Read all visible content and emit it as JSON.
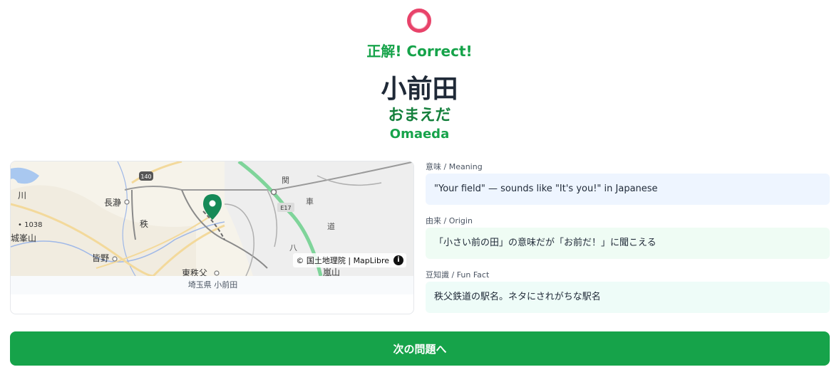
{
  "result": {
    "icon": "circle-correct-icon",
    "verdict": "正解! Correct!",
    "accent_color": "#16a34a",
    "icon_color": "#e8436a"
  },
  "station": {
    "kanji": "小前田",
    "kana": "おまえだ",
    "romaji": "Omaeda"
  },
  "map": {
    "labels": {
      "route_140": "140",
      "nagatoro": "長瀞",
      "kawa": "川",
      "chichi": "秩",
      "elevation": "• 1038",
      "jogamine": "城峯山",
      "minano": "皆野",
      "route_e17": "E17",
      "higashichichibu": "東秩父",
      "ranzan": "嵐山",
      "road_kanji_1": "八",
      "road_kanji_2": "車",
      "road_kanji_3": "道",
      "road_kanji_4": "関"
    },
    "attribution": "© 国土地理院 | MapLibre",
    "info_symbol": "i",
    "caption": "埼玉県 小前田"
  },
  "details": {
    "meaning_label": "意味 / Meaning",
    "meaning": "\"Your field\" — sounds like \"It's you!\" in Japanese",
    "origin_label": "由来 / Origin",
    "origin": "「小さい前の田」の意味だが「お前だ！」に聞こえる",
    "fact_label": "豆知識 / Fun Fact",
    "fact": "秩父鉄道の駅名。ネタにされがちな駅名"
  },
  "next_button": "次の問題へ"
}
